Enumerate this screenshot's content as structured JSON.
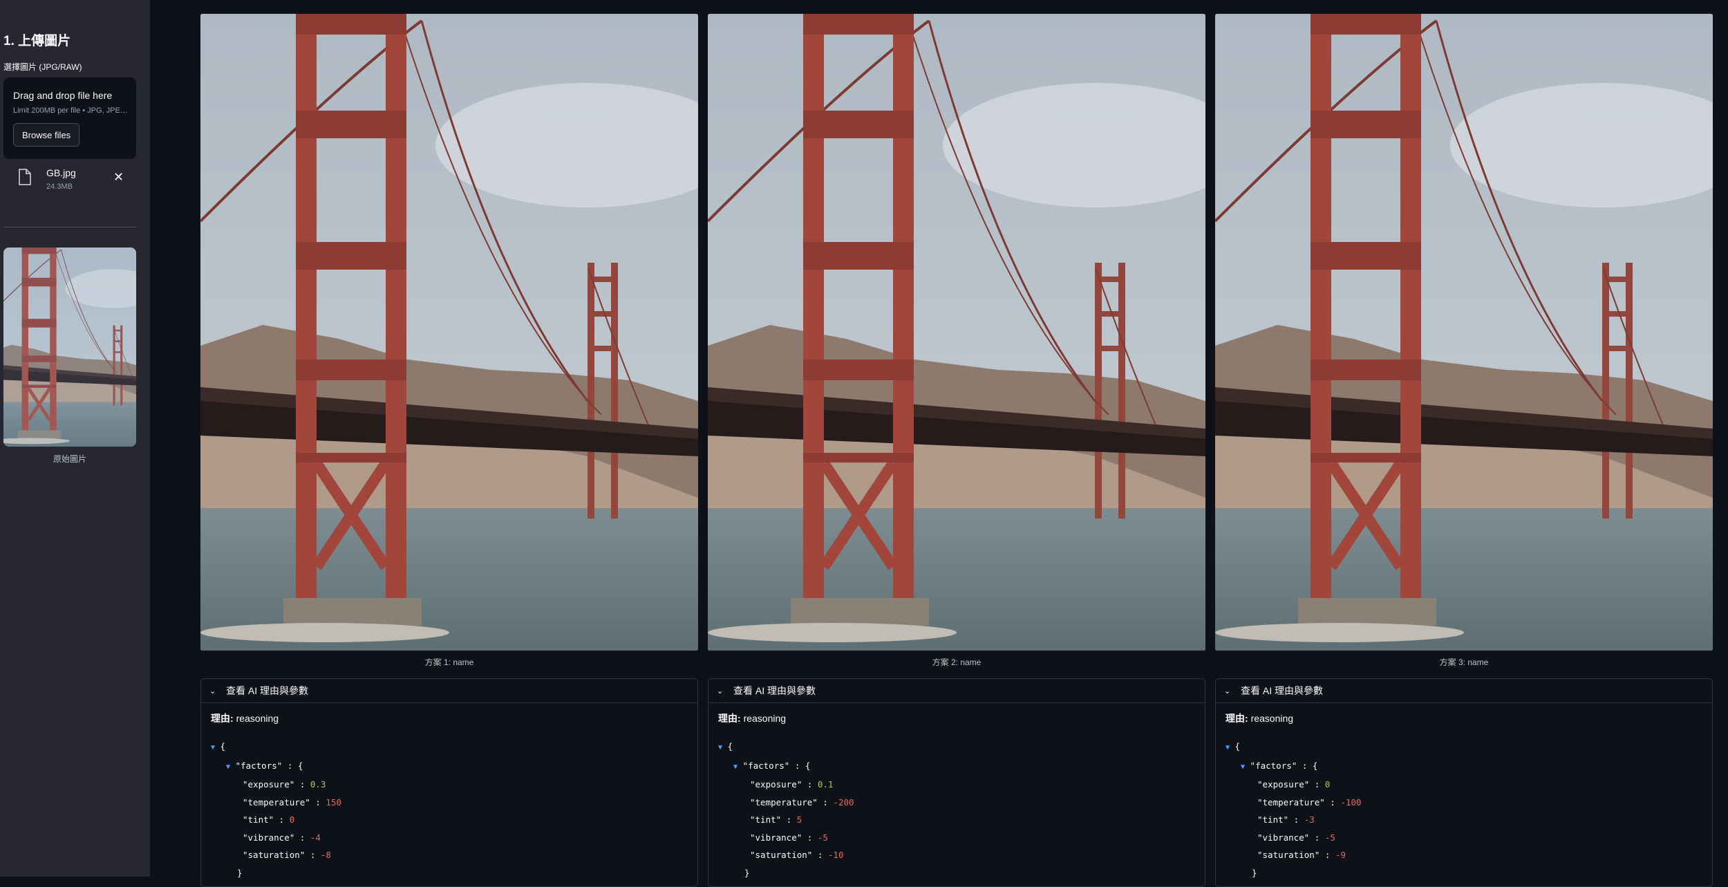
{
  "sidebar": {
    "title": "1. 上傳圖片",
    "uploader_label": "選擇圖片 (JPG/RAW)",
    "dropzone_main": "Drag and drop file here",
    "dropzone_sub": "Limit 200MB per file • JPG, JPEG, PNG, RAW",
    "browse_label": "Browse files",
    "file": {
      "name": "GB.jpg",
      "size": "24.3MB"
    },
    "thumbnail_caption": "原始圖片"
  },
  "expander_label": "查看 AI 理由與參數",
  "reason_prefix": "理由:",
  "columns": [
    {
      "caption": "方案 1: name",
      "reason": "reasoning",
      "factors": {
        "exposure": "0.3",
        "temperature": "150",
        "tint": "0",
        "vibrance": "-4",
        "saturation": "-8"
      }
    },
    {
      "caption": "方案 2: name",
      "reason": "reasoning",
      "factors": {
        "exposure": "0.1",
        "temperature": "-200",
        "tint": "5",
        "vibrance": "-5",
        "saturation": "-10"
      }
    },
    {
      "caption": "方案 3: name",
      "reason": "reasoning",
      "factors": {
        "exposure": "0",
        "temperature": "-100",
        "tint": "-3",
        "vibrance": "-5",
        "saturation": "-9"
      }
    }
  ],
  "colors": {
    "background": "#0e1117",
    "sidebar": "#262730",
    "bridge_red": "#a2453b",
    "json_number": "#a8c85a",
    "json_negative": "#e06c5e"
  }
}
